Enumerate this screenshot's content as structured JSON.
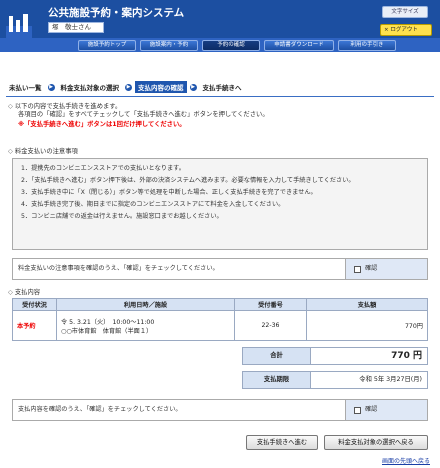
{
  "app": {
    "title": "公共施設予約・案内システム",
    "user_name": "塚　敬士さん"
  },
  "header": {
    "font_size_label": "文字サイズ",
    "logout_label": "× ログアウト"
  },
  "nav": [
    {
      "label": "施設予約トップ"
    },
    {
      "label": "施設案内・予約"
    },
    {
      "label": "予約の確認"
    },
    {
      "label": "申請書ダウンロード"
    },
    {
      "label": "利用の手引き"
    }
  ],
  "steps": [
    {
      "label": "未払い一覧"
    },
    {
      "label": "料金支払対象の選択"
    },
    {
      "label": "支払内容の確認"
    },
    {
      "label": "支払手続きへ"
    }
  ],
  "instructions": {
    "line1": "以下の内容で支払手続きを進めます。",
    "line2": "各項目の「確認」をすべてチェックして「支払手続きへ進む」ボタンを押してください。",
    "warning": "※「支払手続きへ進む」ボタンは1回だけ押してください。"
  },
  "notes_section": {
    "title": "料金支払いの注意事項",
    "items": [
      "1．提携先のコンビニエンスストアでの支払いとなります。",
      "2．「支払手続きへ進む」ボタン押下後は、外部の決済システムへ進みます。必要な情報を入力して手続きしてください。",
      "3．支払手続き中に「X（閉じる）」ボタン等で処理を中断した場合、正しく支払手続きを完了できません。",
      "4．支払手続き完了後、期日までに指定のコンビニエンスストアにて料金を入金してください。",
      "5．コンビニ店舗での返金は行えません。施設窓口までお越しください。"
    ]
  },
  "confirm1": {
    "text": "料金支払いの注意事項を確認のうえ、「確認」をチェックしてください。",
    "check_label": "確認"
  },
  "payment": {
    "title": "支払内容",
    "headers": [
      "受付状況",
      "利用日時／施設",
      "受付番号",
      "支払額"
    ],
    "rows": [
      {
        "status": "本予約",
        "datetime": "令 5. 3.21（火）　10:00～11:00",
        "facility": "○○市体育館　体育館（半面１）",
        "number": "22-36",
        "amount": "770円"
      }
    ],
    "total_label": "合計",
    "total_value": "770 円",
    "due_label": "支払期限",
    "due_value": "令和 5年 3月27日(月)"
  },
  "confirm2": {
    "text": "支払内容を確認のうえ、「確認」をチェックしてください。",
    "check_label": "確認"
  },
  "buttons": {
    "proceed": "支払手続きへ進む",
    "back": "料金支払対象の選択へ戻る"
  },
  "footer": {
    "top_link": "画面の先頭へ戻る"
  }
}
